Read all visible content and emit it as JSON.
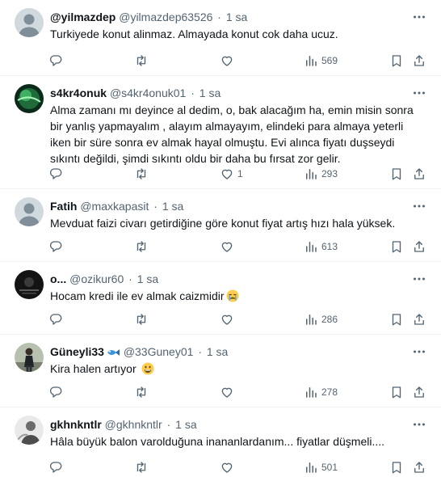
{
  "tweets": [
    {
      "name": "@yilmazdep",
      "handle": "@yilmazdep63526",
      "dot": "·",
      "time": "1 sa",
      "text": "Turkiyede konut alinmaz. Almayada konut cok daha ucuz.",
      "likes": "",
      "views": "569",
      "avatar": "default"
    },
    {
      "name": "s4kr4onuk",
      "handle": "@s4kr4onuk01",
      "dot": "·",
      "time": "1 sa",
      "text": "Alma zamanı mı deyince al dedim, o, bak alacağım ha, emin misin sonra bir yanlış yapmayalım , alayım almayayım, elindeki para almaya yeterli iken bir süre sonra ev almak hayal olmuştu. Evi alınca fiyatı duşseydi sıkıntı değildi, şimdi sıkıntı oldu  bir daha bu fırsat zor gelir.",
      "likes": "1",
      "views": "293",
      "avatar": "green"
    },
    {
      "name": "Fatih",
      "handle": "@maxkapasit",
      "dot": "·",
      "time": "1 sa",
      "text": "Mevduat faizi civarı getirdiğine göre konut fiyat artış hızı hala yüksek.",
      "likes": "",
      "views": "613",
      "avatar": "default"
    },
    {
      "name": "o...",
      "handle": "@ozikur60",
      "dot": "·",
      "time": "1 sa",
      "text": "Hocam  kredi ile ev almak caizmidir",
      "emoji": "crying-face",
      "likes": "",
      "views": "286",
      "avatar": "dark"
    },
    {
      "name": "Güneyli33",
      "name_emoji": "fish",
      "handle": "@33Guney01",
      "dot": "·",
      "time": "1 sa",
      "text": "Kira halen artıyor",
      "emoji": "grinning-face",
      "likes": "",
      "views": "278",
      "avatar": "person"
    },
    {
      "name": "gkhnkntlr",
      "handle": "@gkhnkntlr",
      "dot": "·",
      "time": "1 sa",
      "text": "Hâla büyük balon varolduğuna inananlardanım... fiyatlar düşmeli....",
      "likes": "",
      "views": "501",
      "avatar": "photo"
    }
  ],
  "colors": {
    "text_primary": "#0f1419",
    "text_secondary": "#536471",
    "divider": "#eff3f4"
  }
}
